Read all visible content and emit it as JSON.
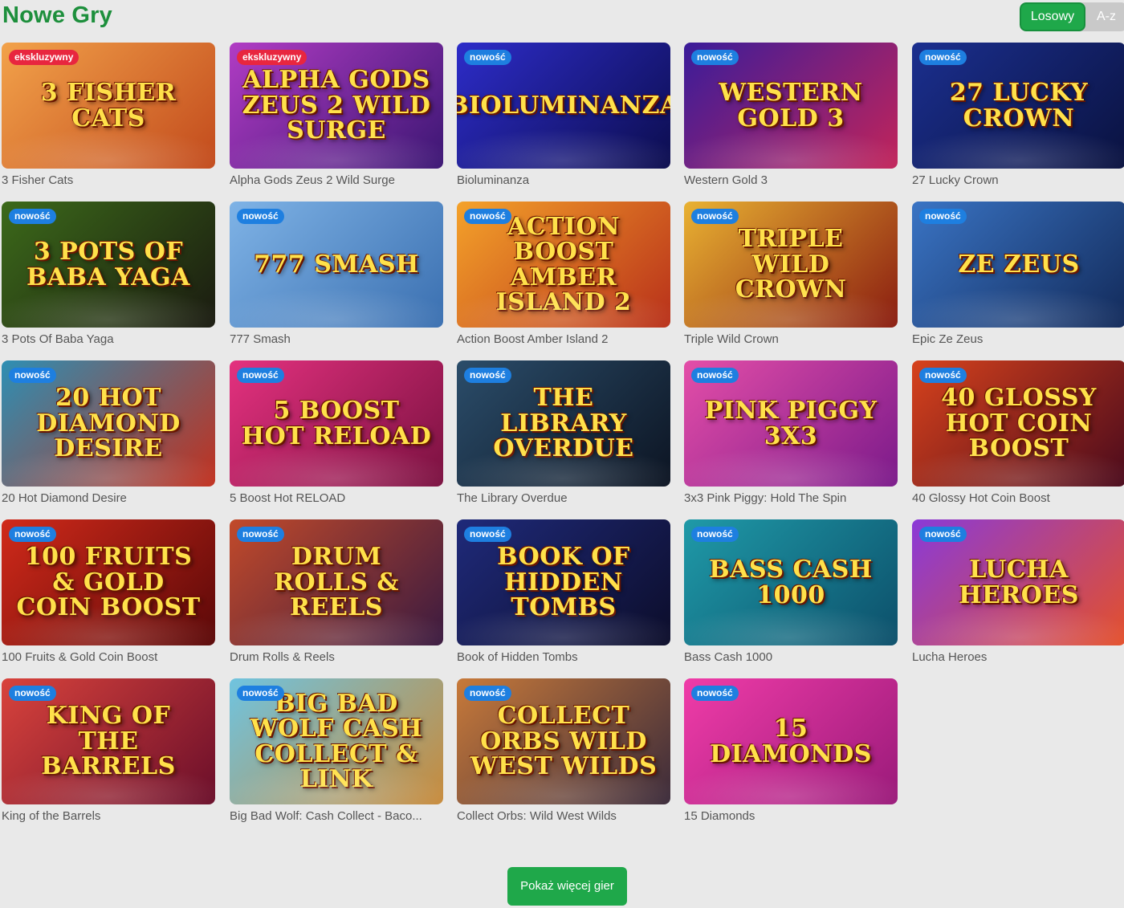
{
  "header": {
    "title": "Nowe Gry",
    "sort": {
      "active_label": "Losowy",
      "inactive_label": "A-z"
    }
  },
  "badges": {
    "new": "nowość",
    "exclusive": "ekskluzywny"
  },
  "games": [
    {
      "title": "3 Fisher Cats",
      "badge": "exclusive",
      "art": "3 Fisher Cats",
      "bg": [
        "#f2a24a",
        "#c24a1c"
      ]
    },
    {
      "title": "Alpha Gods Zeus 2 Wild Surge",
      "badge": "exclusive",
      "art": "Alpha Gods Zeus 2 Wild Surge",
      "bg": [
        "#b13cc4",
        "#3b1673"
      ]
    },
    {
      "title": "Bioluminanza",
      "badge": "new",
      "art": "Bioluminanza",
      "bg": [
        "#2d2cc9",
        "#0c0d4e"
      ]
    },
    {
      "title": "Western Gold 3",
      "badge": "new",
      "art": "Western Gold 3",
      "bg": [
        "#3a1c9a",
        "#c2245a"
      ]
    },
    {
      "title": "27 Lucky Crown",
      "badge": "new",
      "art": "27 Lucky Crown",
      "bg": [
        "#1b2f8f",
        "#0a123f"
      ]
    },
    {
      "title": "3 Pots Of Baba Yaga",
      "badge": "new",
      "art": "3 Pots of Baba Yaga",
      "bg": [
        "#3c6a1a",
        "#1a1a10"
      ]
    },
    {
      "title": "777 Smash",
      "badge": "new",
      "art": "777 Smash",
      "bg": [
        "#7fb3e6",
        "#3a6fb0"
      ]
    },
    {
      "title": "Action Boost Amber Island 2",
      "badge": "new",
      "art": "Action Boost Amber Island 2",
      "bg": [
        "#f4a22a",
        "#b8301a"
      ]
    },
    {
      "title": "Triple Wild Crown",
      "badge": "new",
      "art": "Triple Wild Crown",
      "bg": [
        "#e9b232",
        "#8a1c10"
      ]
    },
    {
      "title": "Epic Ze Zeus",
      "badge": "new",
      "art": "Ze Zeus",
      "bg": [
        "#3a74c4",
        "#122a5a"
      ]
    },
    {
      "title": "20 Hot Diamond Desire",
      "badge": "new",
      "art": "20 Hot Diamond Desire",
      "bg": [
        "#2d8fb4",
        "#c2301e"
      ]
    },
    {
      "title": "5 Boost Hot RELOAD",
      "badge": "new",
      "art": "5 Boost Hot Reload",
      "bg": [
        "#e4317f",
        "#7a1140"
      ]
    },
    {
      "title": "The Library Overdue",
      "badge": "new",
      "art": "The Library Overdue",
      "bg": [
        "#2b4d6a",
        "#0c1422"
      ]
    },
    {
      "title": "3x3 Pink Piggy: Hold The Spin",
      "badge": "new",
      "art": "Pink Piggy 3x3",
      "bg": [
        "#e44ea8",
        "#7b1a8a"
      ]
    },
    {
      "title": "40 Glossy Hot Coin Boost",
      "badge": "new",
      "art": "40 Glossy Hot Coin Boost",
      "bg": [
        "#d7421c",
        "#4a0a1c"
      ]
    },
    {
      "title": "100 Fruits & Gold Coin Boost",
      "badge": "new",
      "art": "100 Fruits & Gold Coin Boost",
      "bg": [
        "#d12a1a",
        "#5a0808"
      ]
    },
    {
      "title": "Drum Rolls & Reels",
      "badge": "new",
      "art": "Drum Rolls & Reels",
      "bg": [
        "#c24a2a",
        "#3a1a40"
      ]
    },
    {
      "title": "Book of Hidden Tombs",
      "badge": "new",
      "art": "Book of Hidden Tombs",
      "bg": [
        "#1f2a7a",
        "#0c0d2a"
      ]
    },
    {
      "title": "Bass Cash 1000",
      "badge": "new",
      "art": "Bass Cash 1000",
      "bg": [
        "#1f9aa8",
        "#0c4f6a"
      ]
    },
    {
      "title": "Lucha Heroes",
      "badge": "new",
      "art": "Lucha Heroes",
      "bg": [
        "#8a3ad8",
        "#e4502a"
      ]
    },
    {
      "title": "King of the Barrels",
      "badge": "new",
      "art": "King of the Barrels",
      "bg": [
        "#d9433c",
        "#6a0e2a"
      ]
    },
    {
      "title": "Big Bad Wolf: Cash Collect - Baco...",
      "badge": "new",
      "art": "Big Bad Wolf Cash Collect & Link",
      "bg": [
        "#6fc4e0",
        "#c88a3a"
      ]
    },
    {
      "title": "Collect Orbs: Wild West Wilds",
      "badge": "new",
      "art": "Collect Orbs Wild West Wilds",
      "bg": [
        "#c87a3a",
        "#3a2a3a"
      ]
    },
    {
      "title": "15 Diamonds",
      "badge": "new",
      "art": "15 Diamonds",
      "bg": [
        "#f03ca8",
        "#9a1a7a"
      ]
    }
  ],
  "more_button": {
    "label": "Pokaż więcej gier"
  }
}
